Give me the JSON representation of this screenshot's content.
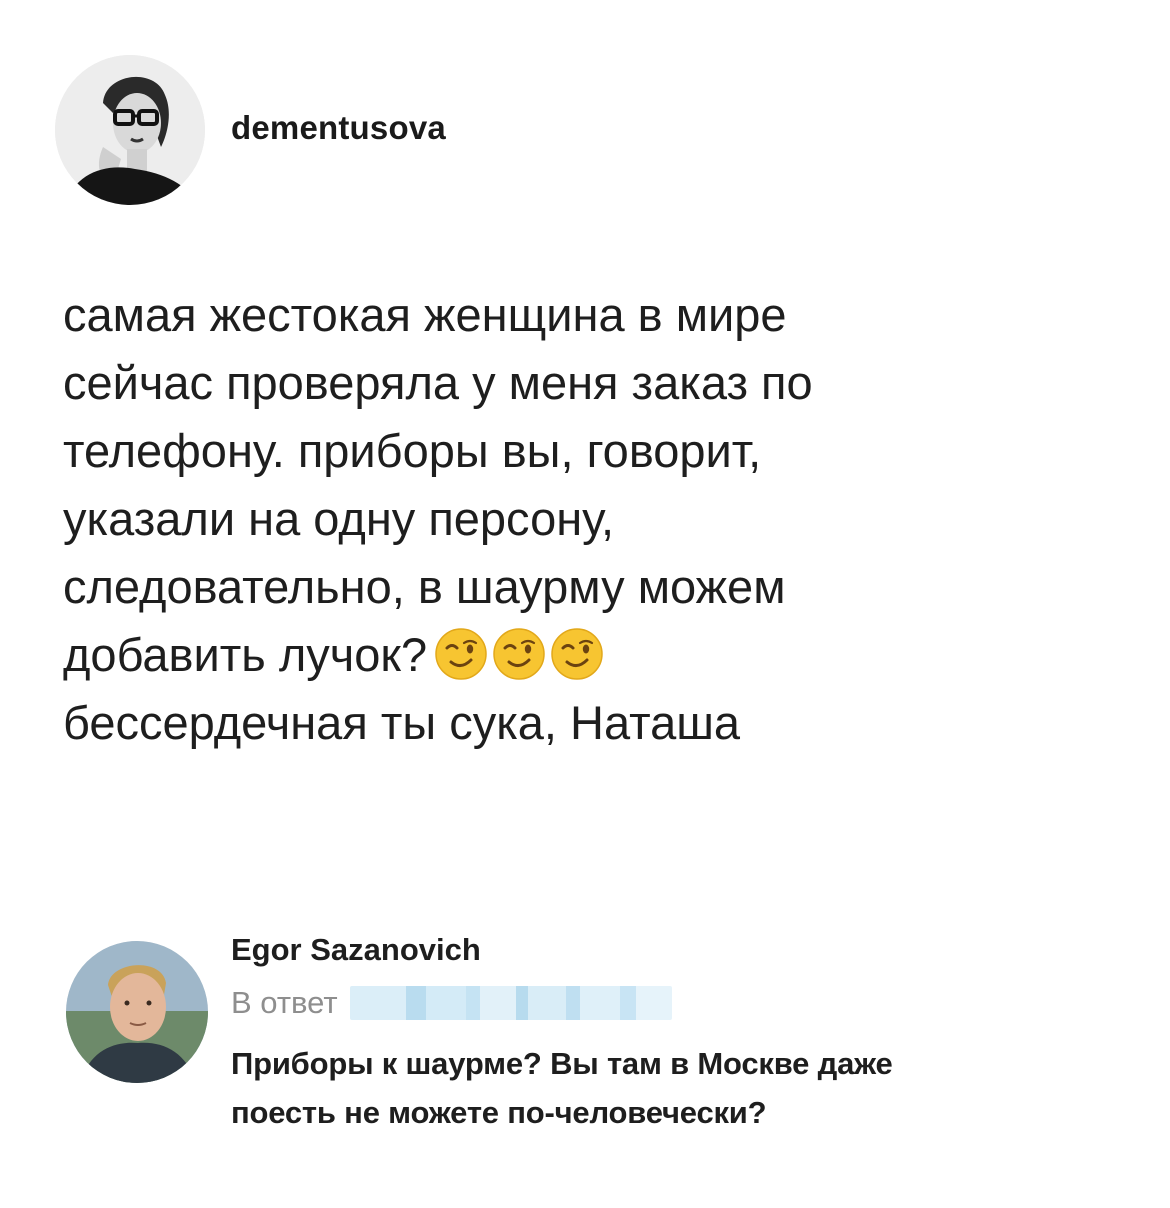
{
  "post": {
    "username": "dementusova",
    "lines": [
      "самая жестокая женщина в мире",
      "сейчас проверяла у меня заказ по",
      "телефону. приборы вы, говорит,",
      "указали на одну персону,",
      "следовательно, в шаурму можем",
      "добавить лучок?",
      "бессердечная ты сука, Наташа"
    ],
    "emoji": [
      "winking-face-icon",
      "winking-face-icon",
      "winking-face-icon"
    ]
  },
  "reply": {
    "author": "Egor Sazanovich",
    "in_reply_to_label": "В ответ",
    "text_lines": [
      "Приборы к шаурме? Вы там в Москве даже",
      "поесть не можете по-человечески?"
    ]
  },
  "colors": {
    "text": "#1e1e1e",
    "muted": "#8e8e8e",
    "emoji_yellow": "#f7c531",
    "blur_blue": "#cfe6f3"
  }
}
